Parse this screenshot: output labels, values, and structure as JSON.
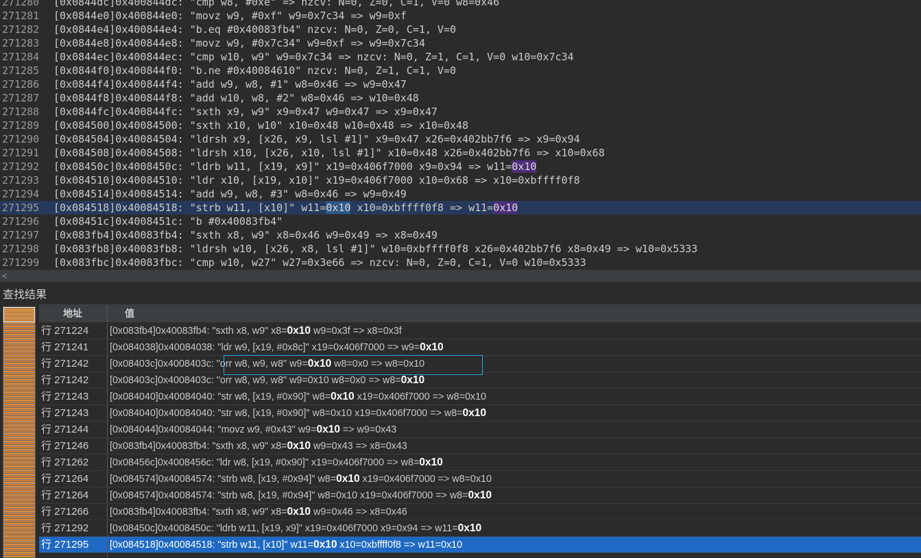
{
  "editor": {
    "lines": [
      {
        "num": "271280",
        "segs": [
          {
            "t": "[0x0844dc]0x400844dc: \"cmp w8, #0xe\" => nzcv: N=0, Z=0, C=1, V=0 w8=0x46"
          }
        ]
      },
      {
        "num": "271281",
        "segs": [
          {
            "t": "[0x0844e0]0x400844e0: \"movz w9, #0xf\" w9=0x7c34 => w9=0xf"
          }
        ]
      },
      {
        "num": "271282",
        "segs": [
          {
            "t": "[0x0844e4]0x400844e4: \"b.eq #0x40083fb4\" nzcv: N=0, Z=0, C=1, V=0"
          }
        ]
      },
      {
        "num": "271283",
        "segs": [
          {
            "t": "[0x0844e8]0x400844e8: \"movz w9, #0x7c34\" w9=0xf => w9=0x7c34"
          }
        ]
      },
      {
        "num": "271284",
        "segs": [
          {
            "t": "[0x0844ec]0x400844ec: \"cmp w10, w9\" w9=0x7c34 => nzcv: N=0, Z=1, C=1, V=0 w10=0x7c34"
          }
        ]
      },
      {
        "num": "271285",
        "segs": [
          {
            "t": "[0x0844f0]0x400844f0: \"b.ne #0x40084610\" nzcv: N=0, Z=1, C=1, V=0"
          }
        ]
      },
      {
        "num": "271286",
        "segs": [
          {
            "t": "[0x0844f4]0x400844f4: \"add w9, w8, #1\" w8=0x46 => w9=0x47"
          }
        ]
      },
      {
        "num": "271287",
        "segs": [
          {
            "t": "[0x0844f8]0x400844f8: \"add w10, w8, #2\" w8=0x46 => w10=0x48"
          }
        ]
      },
      {
        "num": "271288",
        "segs": [
          {
            "t": "[0x0844fc]0x400844fc: \"sxth x9, w9\" x9=0x47 w9=0x47 => x9=0x47"
          }
        ]
      },
      {
        "num": "271289",
        "segs": [
          {
            "t": "[0x084500]0x40084500: \"sxth x10, w10\" x10=0x48 w10=0x48 => x10=0x48"
          }
        ]
      },
      {
        "num": "271290",
        "segs": [
          {
            "t": "[0x084504]0x40084504: \"ldrsh x9, [x26, x9, lsl #1]\" x9=0x47 x26=0x402bb7f6 => x9=0x94"
          }
        ]
      },
      {
        "num": "271291",
        "segs": [
          {
            "t": "[0x084508]0x40084508: \"ldrsh x10, [x26, x10, lsl #1]\" x10=0x48 x26=0x402bb7f6 => x10=0x68"
          }
        ]
      },
      {
        "num": "271292",
        "segs": [
          {
            "t": "[0x08450c]0x4008450c: \"ldrb w11, [x19, x9]\" x19=0x406f7000 x9=0x94 => w11="
          },
          {
            "t": "0x10",
            "hl": "hl"
          }
        ]
      },
      {
        "num": "271293",
        "segs": [
          {
            "t": "[0x084510]0x40084510: \"ldr x10, [x19, x10]\" x19=0x406f7000 x10=0x68 => x10=0xbffff0f8"
          }
        ]
      },
      {
        "num": "271294",
        "segs": [
          {
            "t": "[0x084514]0x40084514: \"add w9, w8, #3\" w8=0x46 => w9=0x49"
          }
        ]
      },
      {
        "num": "271295",
        "current": true,
        "segs": [
          {
            "t": "[0x084518]0x40084518: \"strb w11, [x10]\" w11="
          },
          {
            "t": "0x10",
            "hl": "hl-sel"
          },
          {
            "t": " x10=0xbffff0f8 => w11="
          },
          {
            "t": "0x10",
            "hl": "hl"
          }
        ]
      },
      {
        "num": "271296",
        "segs": [
          {
            "t": "[0x08451c]0x4008451c: \"b #0x40083fb4\""
          }
        ]
      },
      {
        "num": "271297",
        "segs": [
          {
            "t": "[0x083fb4]0x40083fb4: \"sxth x8, w9\" x8=0x46 w9=0x49 => x8=0x49"
          }
        ]
      },
      {
        "num": "271298",
        "segs": [
          {
            "t": "[0x083fb8]0x40083fb8: \"ldrsh w10, [x26, x8, lsl #1]\" w10=0xbffff0f8 x26=0x402bb7f6 x8=0x49 => w10=0x5333"
          }
        ]
      },
      {
        "num": "271299",
        "segs": [
          {
            "t": "[0x083fbc]0x40083fbc: \"cmp w10, w27\" w27=0x3e66 => nzcv: N=0, Z=0, C=1, V=0 w10=0x5333"
          }
        ]
      }
    ]
  },
  "scrollbar": {
    "left_arrow": "<"
  },
  "results": {
    "title": "查找结果",
    "col_addr": "地址",
    "col_val": "值",
    "rows": [
      {
        "addr": "行 271224",
        "segs": [
          {
            "t": "[0x083fb4]0x40083fb4: \"sxth x8, w9\" x8="
          },
          {
            "t": "0x10",
            "b": true
          },
          {
            "t": " w9=0x3f => x8=0x3f"
          }
        ]
      },
      {
        "addr": "行 271241",
        "segs": [
          {
            "t": "[0x084038]0x40084038: \"ldr w9, [x19, #0x8c]\" x19=0x406f7000 => w9="
          },
          {
            "t": "0x10",
            "b": true
          }
        ]
      },
      {
        "addr": "行 271242",
        "segs": [
          {
            "t": "[0x08403c]0x4008403c: \"orr w8, w9, w8\" w9="
          },
          {
            "t": "0x10",
            "b": true
          },
          {
            "t": " w8=0x0 => w8=0x10"
          }
        ]
      },
      {
        "addr": "行 271242",
        "segs": [
          {
            "t": "[0x08403c]0x4008403c: \"orr w8, w9, w8\" w9=0x10 w8=0x0 => w8="
          },
          {
            "t": "0x10",
            "b": true
          }
        ]
      },
      {
        "addr": "行 271243",
        "segs": [
          {
            "t": "[0x084040]0x40084040: \"str w8, [x19, #0x90]\" w8="
          },
          {
            "t": "0x10",
            "b": true
          },
          {
            "t": " x19=0x406f7000 => w8=0x10"
          }
        ]
      },
      {
        "addr": "行 271243",
        "segs": [
          {
            "t": "[0x084040]0x40084040: \"str w8, [x19, #0x90]\" w8=0x10 x19=0x406f7000 => w8="
          },
          {
            "t": "0x10",
            "b": true
          }
        ]
      },
      {
        "addr": "行 271244",
        "segs": [
          {
            "t": "[0x084044]0x40084044: \"movz w9, #0x43\" w9="
          },
          {
            "t": "0x10",
            "b": true
          },
          {
            "t": " => w9=0x43"
          }
        ]
      },
      {
        "addr": "行 271246",
        "segs": [
          {
            "t": "[0x083fb4]0x40083fb4: \"sxth x8, w9\" x8="
          },
          {
            "t": "0x10",
            "b": true
          },
          {
            "t": " w9=0x43 => x8=0x43"
          }
        ]
      },
      {
        "addr": "行 271262",
        "segs": [
          {
            "t": "[0x08456c]0x4008456c: \"ldr w8, [x19, #0x90]\" x19=0x406f7000 => w8="
          },
          {
            "t": "0x10",
            "b": true
          }
        ]
      },
      {
        "addr": "行 271264",
        "segs": [
          {
            "t": "[0x084574]0x40084574: \"strb w8, [x19, #0x94]\" w8="
          },
          {
            "t": "0x10",
            "b": true
          },
          {
            "t": " x19=0x406f7000 => w8=0x10"
          }
        ]
      },
      {
        "addr": "行 271264",
        "segs": [
          {
            "t": "[0x084574]0x40084574: \"strb w8, [x19, #0x94]\" w8=0x10 x19=0x406f7000 => w8="
          },
          {
            "t": "0x10",
            "b": true
          }
        ]
      },
      {
        "addr": "行 271266",
        "segs": [
          {
            "t": "[0x083fb4]0x40083fb4: \"sxth x8, w9\" x8="
          },
          {
            "t": "0x10",
            "b": true
          },
          {
            "t": " w9=0x46 => x8=0x46"
          }
        ]
      },
      {
        "addr": "行 271292",
        "segs": [
          {
            "t": "[0x08450c]0x4008450c: \"ldrb w11, [x19, x9]\" x19=0x406f7000 x9=0x94 => w11="
          },
          {
            "t": "0x10",
            "b": true
          }
        ]
      },
      {
        "addr": "行 271295",
        "selected": true,
        "segs": [
          {
            "t": "[0x084518]0x40084518: \"strb w11, [x10]\" w11="
          },
          {
            "t": "0x10",
            "b": true
          },
          {
            "t": " x10=0xbffff0f8 => w11=0x10"
          }
        ]
      },
      {
        "addr": "",
        "segs": [
          {
            "t": ""
          }
        ]
      }
    ]
  }
}
